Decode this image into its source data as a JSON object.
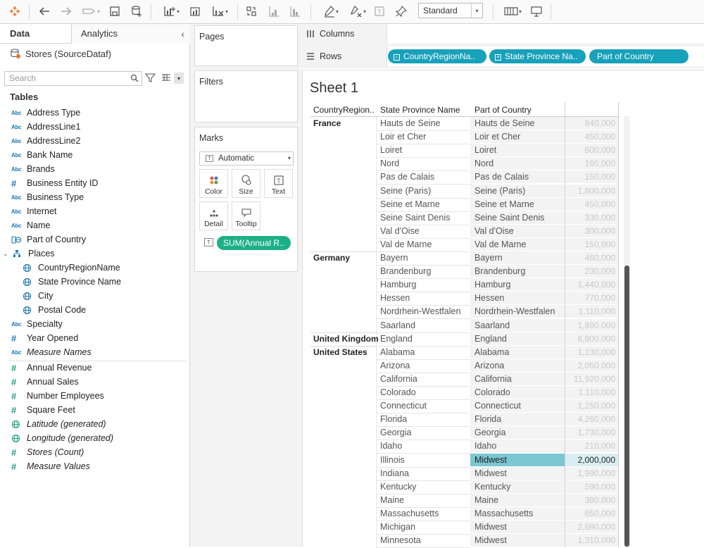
{
  "toolbar": {
    "fit_label": "Standard",
    "icons": [
      "tableau-logo-icon",
      "undo-icon",
      "redo-icon",
      "replay-icon",
      "save-icon",
      "new-datasource-icon",
      "new-worksheet-icon",
      "duplicate-icon",
      "clear-icon",
      "swap-icon",
      "sort-asc-icon",
      "sort-desc-icon",
      "highlight-icon",
      "group-icon",
      "label-icon",
      "pin-icon",
      "show-cards-icon",
      "presentation-icon"
    ]
  },
  "data_pane": {
    "tab_data": "Data",
    "tab_analytics": "Analytics",
    "datasource": "Stores (SourceDataf)",
    "search_placeholder": "Search",
    "tables_header": "Tables",
    "fields": [
      {
        "type": "abc",
        "label": "Address Type"
      },
      {
        "type": "abc",
        "label": "AddressLine1"
      },
      {
        "type": "abc",
        "label": "AddressLine2"
      },
      {
        "type": "abc",
        "label": "Bank Name"
      },
      {
        "type": "abc",
        "label": "Brands"
      },
      {
        "type": "hash-blue",
        "label": "Business Entity ID"
      },
      {
        "type": "abc",
        "label": "Business Type"
      },
      {
        "type": "abc",
        "label": "Internet"
      },
      {
        "type": "abc",
        "label": "Name"
      },
      {
        "type": "geo-group",
        "label": "Part of Country"
      },
      {
        "type": "hierarchy",
        "label": "Places"
      },
      {
        "type": "globe",
        "label": "CountryRegionName"
      },
      {
        "type": "globe",
        "label": "State Province Name"
      },
      {
        "type": "globe",
        "label": "City"
      },
      {
        "type": "globe",
        "label": "Postal Code"
      },
      {
        "type": "abc",
        "label": "Specialty"
      },
      {
        "type": "hash-blue",
        "label": "Year Opened"
      },
      {
        "type": "abc",
        "label": "Measure Names"
      },
      {
        "type": "hash",
        "label": "Annual Revenue"
      },
      {
        "type": "hash",
        "label": "Annual Sales"
      },
      {
        "type": "hash",
        "label": "Number Employees"
      },
      {
        "type": "hash",
        "label": "Square Feet"
      },
      {
        "type": "globe",
        "label": "Latitude (generated)"
      },
      {
        "type": "globe",
        "label": "Longitude (generated)"
      },
      {
        "type": "hash",
        "label": "Stores (Count)"
      },
      {
        "type": "hash",
        "label": "Measure Values"
      }
    ]
  },
  "cards": {
    "pages": "Pages",
    "filters": "Filters",
    "marks": "Marks",
    "marks_type": "Automatic",
    "color": "Color",
    "size": "Size",
    "text": "Text",
    "detail": "Detail",
    "tooltip": "Tooltip",
    "measure_pill": "SUM(Annual R.."
  },
  "shelves": {
    "columns": "Columns",
    "rows": "Rows",
    "row_pills": [
      "CountryRegionNa..",
      "State Province Na..",
      "Part of Country"
    ]
  },
  "sheet": {
    "title": "Sheet 1",
    "headers": {
      "country": "CountryRegion..",
      "state": "State Province Name",
      "part": "Part of Country"
    },
    "rows": [
      {
        "country": "France",
        "state": "Hauts de Seine",
        "part": "Hauts de Seine",
        "value": "840,000"
      },
      {
        "country": "",
        "state": "Loir et Cher",
        "part": "Loir et Cher",
        "value": "450,000"
      },
      {
        "country": "",
        "state": "Loiret",
        "part": "Loiret",
        "value": "600,000"
      },
      {
        "country": "",
        "state": "Nord",
        "part": "Nord",
        "value": "160,000"
      },
      {
        "country": "",
        "state": "Pas de Calais",
        "part": "Pas de Calais",
        "value": "150,000"
      },
      {
        "country": "",
        "state": "Seine (Paris)",
        "part": "Seine (Paris)",
        "value": "1,800,000"
      },
      {
        "country": "",
        "state": "Seine et Marne",
        "part": "Seine et Marne",
        "value": "450,000"
      },
      {
        "country": "",
        "state": "Seine Saint Denis",
        "part": "Seine Saint Denis",
        "value": "330,000"
      },
      {
        "country": "",
        "state": "Val d'Oise",
        "part": "Val d'Oise",
        "value": "300,000"
      },
      {
        "country": "",
        "state": "Val de Marne",
        "part": "Val de Marne",
        "value": "150,000"
      },
      {
        "country": "Germany",
        "state": "Bayern",
        "part": "Bayern",
        "value": "460,000"
      },
      {
        "country": "",
        "state": "Brandenburg",
        "part": "Brandenburg",
        "value": "230,000"
      },
      {
        "country": "",
        "state": "Hamburg",
        "part": "Hamburg",
        "value": "1,440,000"
      },
      {
        "country": "",
        "state": "Hessen",
        "part": "Hessen",
        "value": "770,000"
      },
      {
        "country": "",
        "state": "Nordrhein-Westfalen",
        "part": "Nordrhein-Westfalen",
        "value": "1,110,000"
      },
      {
        "country": "",
        "state": "Saarland",
        "part": "Saarland",
        "value": "1,890,000"
      },
      {
        "country": "United Kingdom",
        "state": "England",
        "part": "England",
        "value": "6,800,000"
      },
      {
        "country": "United States",
        "state": "Alabama",
        "part": "Alabama",
        "value": "1,130,000"
      },
      {
        "country": "",
        "state": "Arizona",
        "part": "Arizona",
        "value": "2,050,000"
      },
      {
        "country": "",
        "state": "California",
        "part": "California",
        "value": "11,920,000"
      },
      {
        "country": "",
        "state": "Colorado",
        "part": "Colorado",
        "value": "1,110,000"
      },
      {
        "country": "",
        "state": "Connecticut",
        "part": "Connecticut",
        "value": "1,250,000"
      },
      {
        "country": "",
        "state": "Florida",
        "part": "Florida",
        "value": "4,260,000"
      },
      {
        "country": "",
        "state": "Georgia",
        "part": "Georgia",
        "value": "1,730,000"
      },
      {
        "country": "",
        "state": "Idaho",
        "part": "Idaho",
        "value": "210,000"
      },
      {
        "country": "",
        "state": "Illinois",
        "part": "Midwest",
        "value": "2,000,000",
        "highlighted": true
      },
      {
        "country": "",
        "state": "Indiana",
        "part": "Midwest",
        "value": "1,990,000"
      },
      {
        "country": "",
        "state": "Kentucky",
        "part": "Kentucky",
        "value": "590,000"
      },
      {
        "country": "",
        "state": "Maine",
        "part": "Maine",
        "value": "380,000"
      },
      {
        "country": "",
        "state": "Massachusetts",
        "part": "Massachusetts",
        "value": "650,000"
      },
      {
        "country": "",
        "state": "Michigan",
        "part": "Midwest",
        "value": "2,690,000"
      },
      {
        "country": "",
        "state": "Minnesota",
        "part": "Midwest",
        "value": "1,310,000"
      }
    ]
  },
  "colors": {
    "pill_green": "#1db088",
    "pill_blue": "#17a1ba",
    "highlight": "#7bc7d2"
  }
}
